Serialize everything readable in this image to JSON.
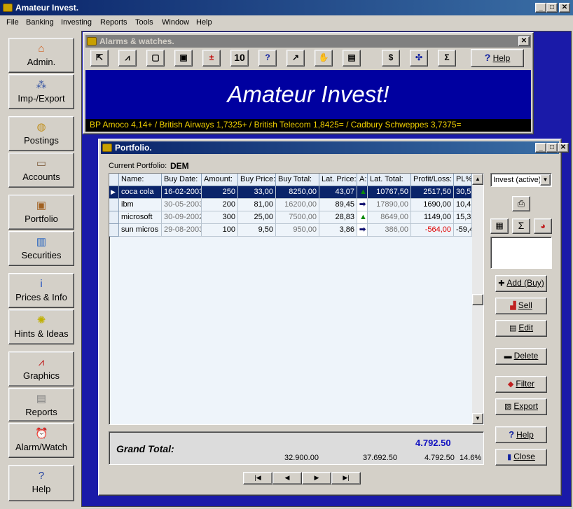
{
  "app": {
    "title": "Amateur Invest."
  },
  "menu": [
    "File",
    "Banking",
    "Investing",
    "Reports",
    "Tools",
    "Window",
    "Help"
  ],
  "nav": [
    {
      "label": "Admin.",
      "icon": "house-icon",
      "glyph": "⌂",
      "color": "#d06020"
    },
    {
      "label": "Imp-/Export",
      "icon": "network-icon",
      "glyph": "⁂",
      "color": "#3050a0"
    },
    {
      "label": "Postings",
      "icon": "coins-icon",
      "glyph": "◍",
      "color": "#c09020"
    },
    {
      "label": "Accounts",
      "icon": "card-icon",
      "glyph": "▭",
      "color": "#806040"
    },
    {
      "label": "Portfolio",
      "icon": "briefcase-icon",
      "glyph": "▣",
      "color": "#a06020"
    },
    {
      "label": "Securities",
      "icon": "ticket-icon",
      "glyph": "▥",
      "color": "#2060c0"
    },
    {
      "label": "Prices & Info",
      "icon": "info-icon",
      "glyph": "i",
      "color": "#2050c0"
    },
    {
      "label": "Hints & Ideas",
      "icon": "lightbulb-icon",
      "glyph": "✺",
      "color": "#c0b000"
    },
    {
      "label": "Graphics",
      "icon": "chart-icon",
      "glyph": "⩘",
      "color": "#c02020"
    },
    {
      "label": "Reports",
      "icon": "clipboard-icon",
      "glyph": "▤",
      "color": "#808080"
    },
    {
      "label": "Alarm/Watch",
      "icon": "alarm-clock-icon",
      "glyph": "⏰",
      "color": "#c02020"
    },
    {
      "label": "Help",
      "icon": "question-icon",
      "glyph": "?",
      "color": "#2040a0"
    }
  ],
  "alarms": {
    "title": "Alarms & watches.",
    "toolbar": [
      "10"
    ],
    "help_label": "Help",
    "banner": "Amateur Invest!",
    "ticker": "BP Amoco 4,14+ / British Airways 1,7325+ / British Telecom 1,8425= / Cadbury Schweppes 3,7375="
  },
  "portfolio": {
    "title": "Portfolio.",
    "current_label": "Current Portfolio:",
    "current_value": "DEM",
    "columns": [
      "Name:",
      "Buy Date:",
      "Amount:",
      "Buy Price:",
      "Buy Total:",
      "Lat. Price:",
      "A:",
      "Lat. Total:",
      "Profit/Loss:",
      "PL%"
    ],
    "rows": [
      {
        "name": "coca cola",
        "buy_date": "16-02-2003",
        "amount": "250",
        "buy_price": "33,00",
        "buy_total": "8250,00",
        "lat_price": "43,07",
        "trend": "up",
        "lat_total": "10767,50",
        "profit": "2517,50",
        "pl": "30,5",
        "neg": false
      },
      {
        "name": "ibm",
        "buy_date": "30-05-2003",
        "amount": "200",
        "buy_price": "81,00",
        "buy_total": "16200,00",
        "lat_price": "89,45",
        "trend": "right",
        "lat_total": "17890,00",
        "profit": "1690,00",
        "pl": "10,4",
        "neg": false
      },
      {
        "name": "microsoft",
        "buy_date": "30-09-2002",
        "amount": "300",
        "buy_price": "25,00",
        "buy_total": "7500,00",
        "lat_price": "28,83",
        "trend": "up",
        "lat_total": "8649,00",
        "profit": "1149,00",
        "pl": "15,3",
        "neg": false
      },
      {
        "name": "sun micros",
        "buy_date": "29-08-2003",
        "amount": "100",
        "buy_price": "9,50",
        "buy_total": "950,00",
        "lat_price": "3,86",
        "trend": "right",
        "lat_total": "386,00",
        "profit": "-564,00",
        "pl": "-59,4",
        "neg": true
      }
    ],
    "selected_row": 0,
    "dropdown_value": "Invest (active)",
    "buttons": {
      "add": "Add (Buy)",
      "sell": "Sell",
      "edit": "Edit",
      "delete": "Delete",
      "filter": "Filter",
      "export": "Export",
      "help": "Help",
      "close": "Close"
    },
    "grand_total": {
      "label": "Grand Total:",
      "profit_big": "4.792.50",
      "buy_total": "32.900.00",
      "lat_total": "37.692.50",
      "profit": "4.792.50",
      "pct": "14.6%"
    },
    "nav_buttons": [
      "|◀",
      "◀",
      "▶",
      "▶|"
    ]
  },
  "colors": {
    "title_active": "#0a246a",
    "title_inactive": "#808080",
    "mdi_bg": "#1a1aa8",
    "banner_bg": "#0000a0",
    "up_arrow": "#0a8a0a",
    "right_arrow": "#101070",
    "grand_total_blue": "#1010c0"
  }
}
